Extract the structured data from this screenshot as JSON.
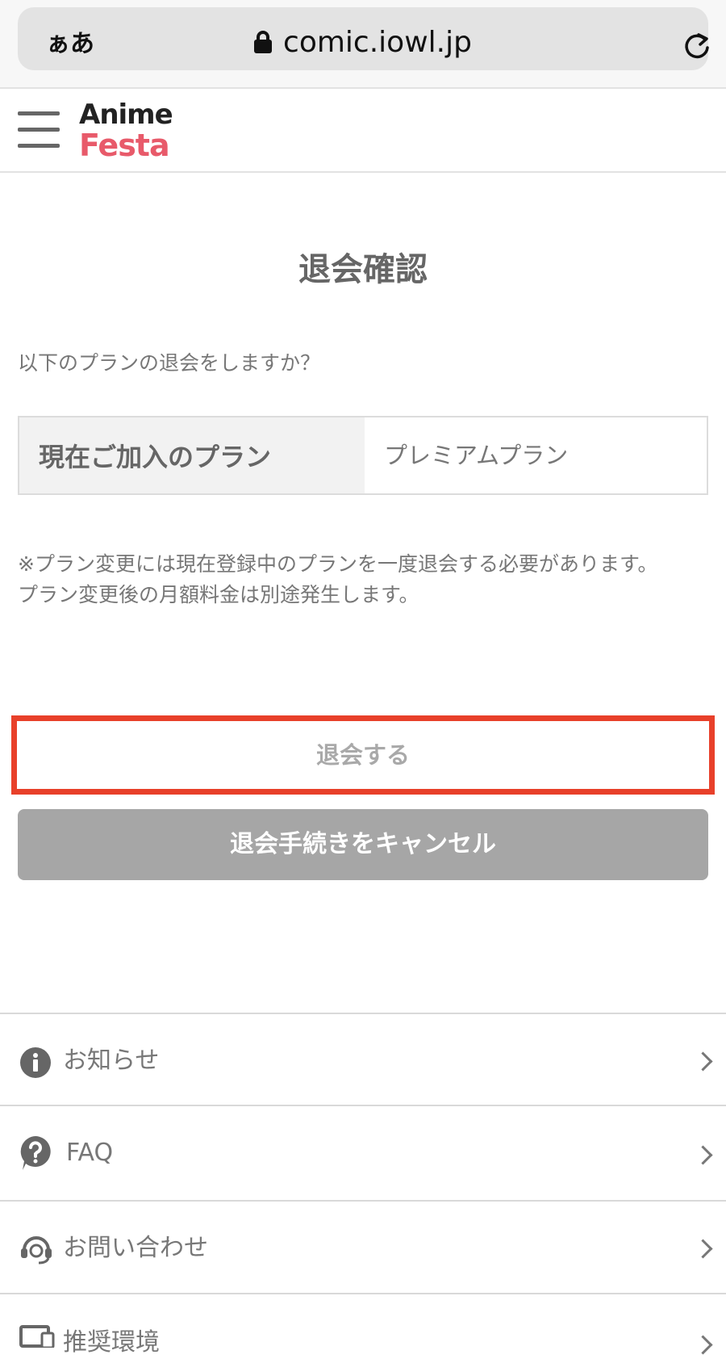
{
  "browser": {
    "text_size_label": "ぁあ",
    "url": "comic.iowl.jp"
  },
  "site": {
    "logo_line1": "Anime",
    "logo_line2": "Festa",
    "brand_color": "#e85a6a"
  },
  "main": {
    "title": "退会確認",
    "question": "以下のプランの退会をしますか？",
    "plan_table": {
      "header": "現在ご加入のプラン",
      "value": "プレミアムプラン"
    },
    "note_line1": "※プラン変更には現在登録中のプランを一度退会する必要があります。",
    "note_line2": "プラン変更後の月額料金は別途発生します。",
    "withdraw_button": "退会する",
    "cancel_button": "退会手続きをキャンセル",
    "highlight_color": "#e8402a"
  },
  "footer_menu": [
    {
      "label": "お知らせ",
      "icon": "info-icon"
    },
    {
      "label": "FAQ",
      "icon": "question-icon"
    },
    {
      "label": "お問い合わせ",
      "icon": "support-icon"
    },
    {
      "label": "推奨環境",
      "icon": "device-icon"
    }
  ]
}
